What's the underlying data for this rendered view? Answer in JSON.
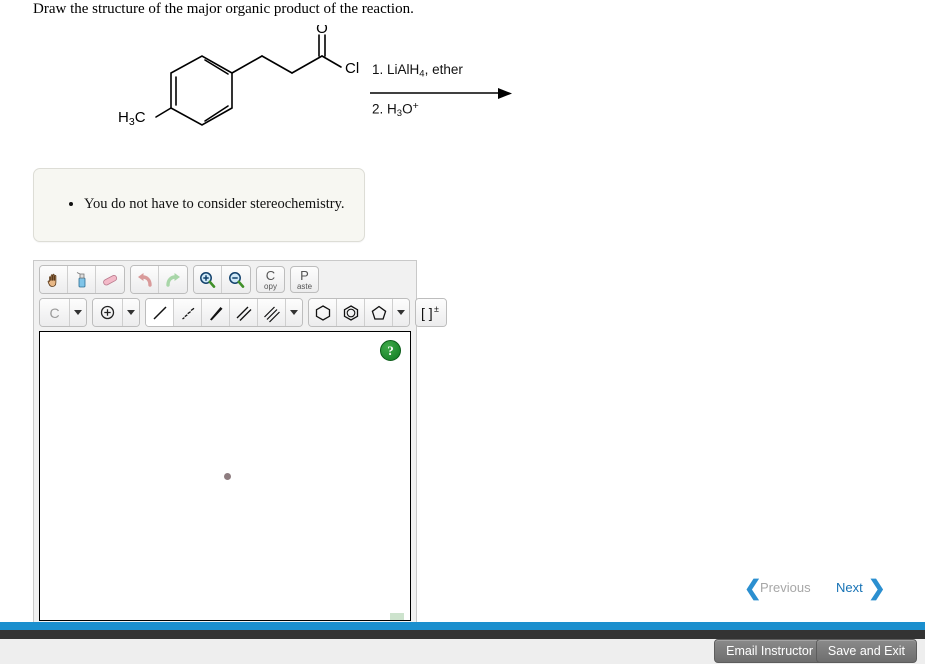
{
  "prompt": {
    "text": "Draw the structure of the major organic product of the reaction."
  },
  "reaction": {
    "reactant_name": "3-(4-methylphenyl)propanoyl chloride",
    "labels": {
      "methyl": "H3C",
      "methyl_html": "H<sub>3</sub>C",
      "oxygen": "O",
      "chlorine": "Cl"
    },
    "reagents": {
      "step1": "1. LiAlH4, ether",
      "step1_html": "1. LiAlH<sub>4</sub>, ether",
      "step2": "2. H3O+",
      "step2_html": "2. H<sub>3</sub>O<sup>+</sup>"
    },
    "arrow_icon": "reaction-arrow-right"
  },
  "note": {
    "items": [
      "You do not have to consider stereochemistry."
    ]
  },
  "sketcher": {
    "toolbar_row1": [
      {
        "name": "pan-hand-tool",
        "icon": "hand-icon",
        "label": ""
      },
      {
        "name": "eraser-spray-tool",
        "icon": "spray-bottle-icon",
        "label": ""
      },
      {
        "name": "eraser-tool",
        "icon": "eraser-icon",
        "label": ""
      },
      {
        "name": "undo-button",
        "icon": "undo-arrow-icon",
        "label": ""
      },
      {
        "name": "redo-button",
        "icon": "redo-arrow-icon",
        "label": ""
      },
      {
        "name": "zoom-in-button",
        "icon": "magnifier-plus-icon",
        "label": ""
      },
      {
        "name": "zoom-out-button",
        "icon": "magnifier-minus-icon",
        "label": ""
      }
    ],
    "copy_button": {
      "big": "C",
      "small": "opy"
    },
    "paste_button": {
      "big": "P",
      "small": "aste"
    },
    "element_selector": {
      "label": "C",
      "caret": "chevron-down-icon"
    },
    "charge_selector": {
      "label": "+",
      "caret": "chevron-down-icon"
    },
    "bond_tools": [
      {
        "name": "single-bond-tool",
        "icon": "single-bond-icon",
        "selected": true
      },
      {
        "name": "hash-wedge-bond-tool",
        "icon": "hashed-wedge-bond-icon",
        "selected": false
      },
      {
        "name": "wedge-bond-tool",
        "icon": "solid-wedge-bond-icon",
        "selected": false
      },
      {
        "name": "double-bond-tool",
        "icon": "double-bond-icon",
        "selected": false
      },
      {
        "name": "triple-bond-tool",
        "icon": "triple-bond-icon",
        "selected": false
      }
    ],
    "ring_tools": [
      {
        "name": "cyclohexane-ring-tool",
        "icon": "hexagon-icon"
      },
      {
        "name": "benzene-ring-tool",
        "icon": "benzene-ring-icon"
      },
      {
        "name": "cyclopentane-ring-tool",
        "icon": "pentagon-icon"
      }
    ],
    "bracket_tool": {
      "name": "bracket-charge-tool",
      "label": "[ ]",
      "sup": "±"
    },
    "canvas": {
      "help_label": "?",
      "atom_cursor": "atom-placement-dot"
    }
  },
  "pager": {
    "previous": {
      "label": "Previous",
      "enabled": false,
      "icon": "chevron-left-icon"
    },
    "next": {
      "label": "Next",
      "enabled": true,
      "icon": "chevron-right-icon"
    }
  },
  "footer": {
    "email_button": "Email Instructor",
    "save_button": "Save and Exit"
  },
  "colors": {
    "accent_blue": "#1b8fce",
    "link_blue": "#1672b5",
    "note_bg": "#f7f7f2",
    "toolbar_bg": "#f1f1f1",
    "footer_btn": "#7b7b7b"
  }
}
